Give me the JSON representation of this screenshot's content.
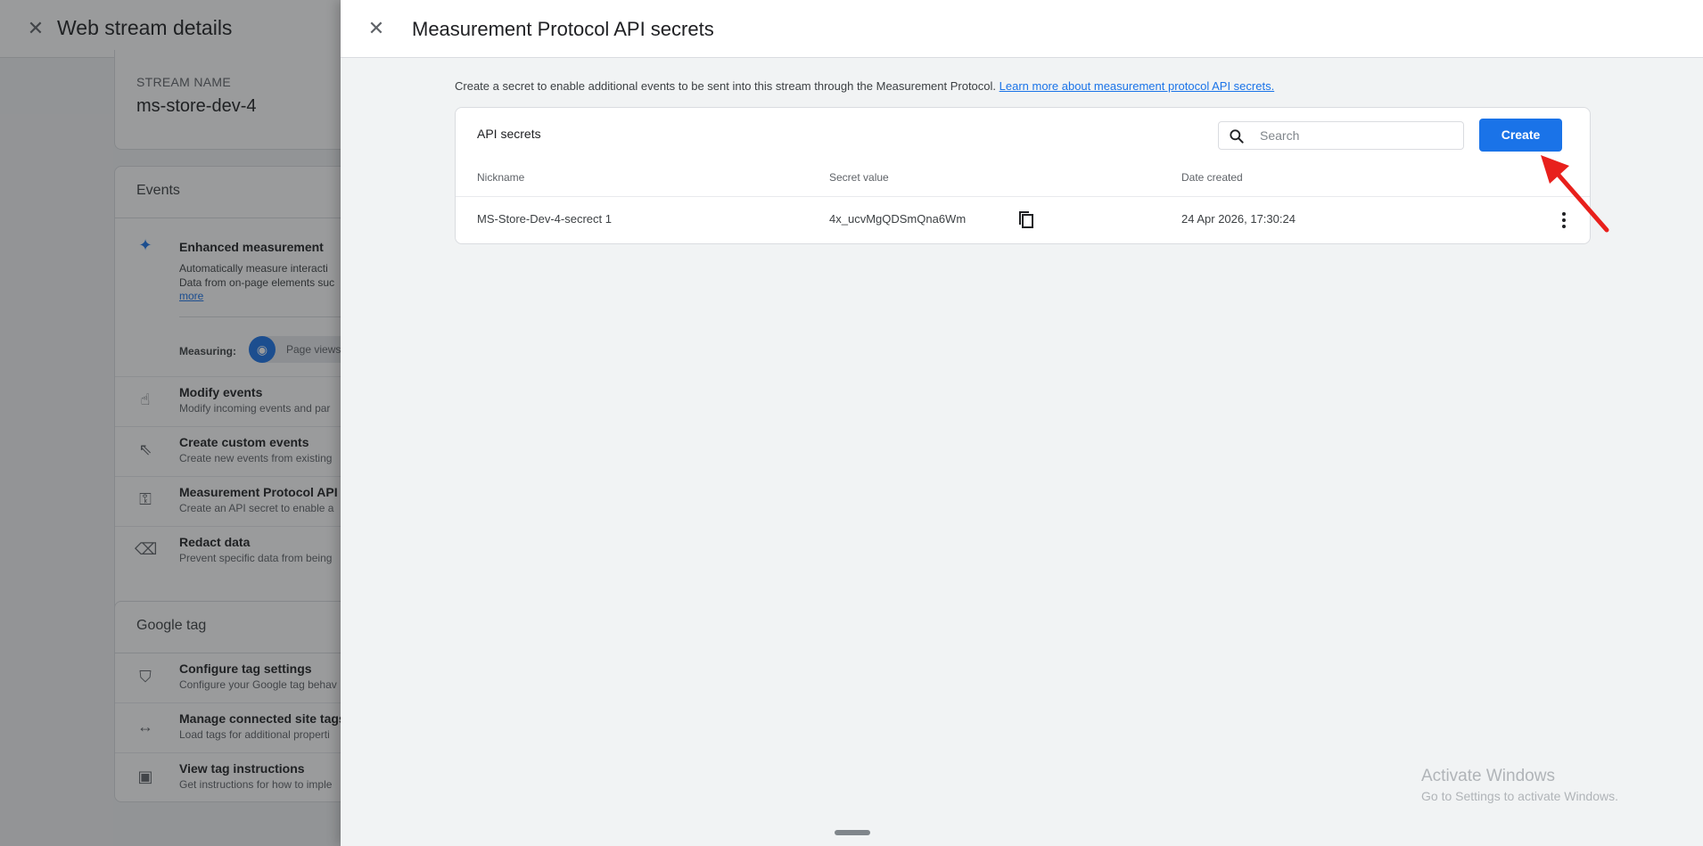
{
  "background": {
    "title": "Web stream details",
    "stream_label": "STREAM NAME",
    "stream_value": "ms-store-dev-4",
    "events_header": "Events",
    "enhanced": {
      "title": "Enhanced measurement",
      "desc_line1": "Automatically measure interacti",
      "desc_line2": "Data from on-page elements suc",
      "more": "more",
      "measuring_label": "Measuring:",
      "measuring_chip": "Page views"
    },
    "event_items": [
      {
        "title": "Modify events",
        "desc": "Modify incoming events and par"
      },
      {
        "title": "Create custom events",
        "desc": "Create new events from existing"
      },
      {
        "title": "Measurement Protocol API s",
        "desc": "Create an API secret to enable a"
      },
      {
        "title": "Redact data",
        "desc": "Prevent specific data from being"
      }
    ],
    "gtag_header": "Google tag",
    "gtag_items": [
      {
        "title": "Configure tag settings",
        "desc": "Configure your Google tag behav"
      },
      {
        "title": "Manage connected site tags",
        "desc": "Load tags for additional properti"
      },
      {
        "title": "View tag instructions",
        "desc": "Get instructions for how to imple"
      }
    ]
  },
  "panel": {
    "title": "Measurement Protocol API secrets",
    "intro": "Create a secret to enable additional events to be sent into this stream through the Measurement Protocol.",
    "intro_link": "Learn more about measurement protocol API secrets.",
    "card_title": "API secrets",
    "search_placeholder": "Search",
    "create_label": "Create",
    "columns": {
      "nickname": "Nickname",
      "secret": "Secret value",
      "date": "Date created"
    },
    "rows": [
      {
        "nickname": "MS-Store-Dev-4-secrect 1",
        "secret": "4x_ucvMgQDSmQna6Wm",
        "date": "24 Apr 2026, 17:30:24"
      }
    ]
  },
  "watermark": {
    "title": "Activate Windows",
    "sub": "Go to Settings to activate Windows."
  },
  "colors": {
    "accent": "#1a73e8",
    "arrow": "#e8201c"
  }
}
